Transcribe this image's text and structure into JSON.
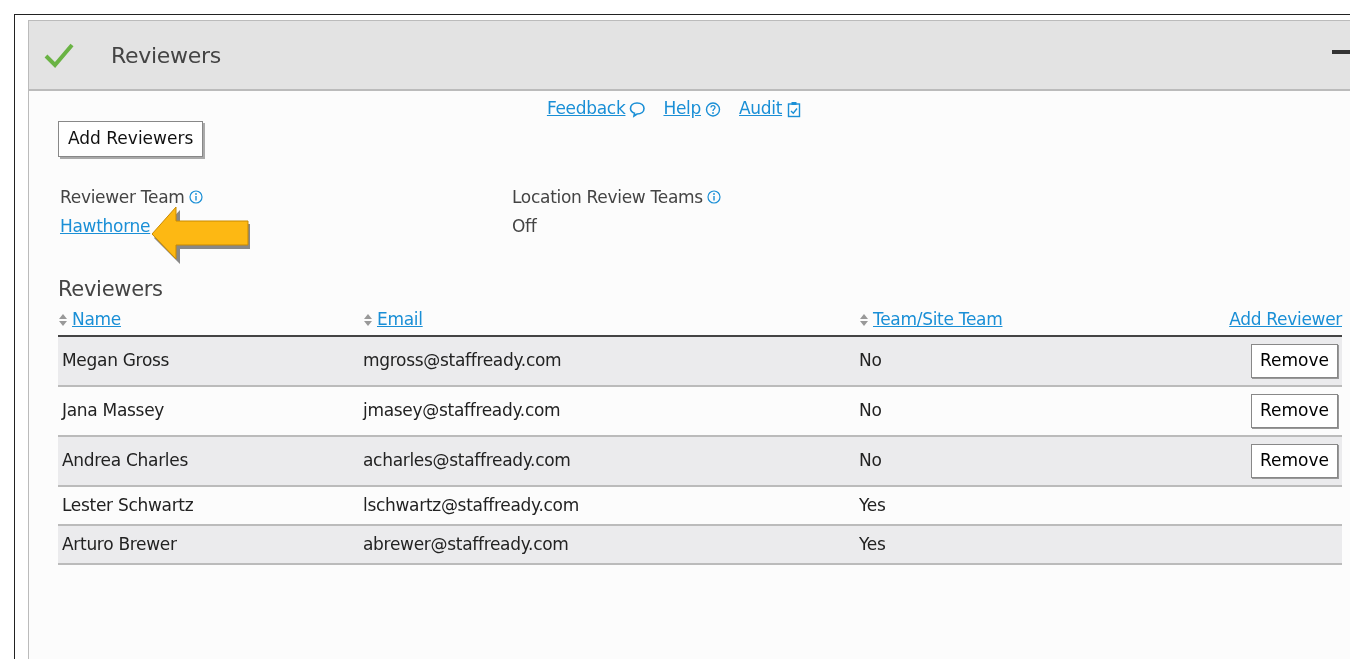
{
  "panel": {
    "title": "Reviewers",
    "complete": true
  },
  "links": [
    {
      "label": "Feedback",
      "kind": "comment"
    },
    {
      "label": "Help",
      "kind": "help"
    },
    {
      "label": "Audit",
      "kind": "clipboard"
    }
  ],
  "add_button": "Add Reviewers",
  "fields": [
    {
      "label": "Reviewer Team",
      "value": "Hawthorne",
      "kind": "link"
    },
    {
      "label": "Location Review Teams",
      "value": "Off",
      "kind": "text"
    }
  ],
  "table": {
    "title": "Reviewers",
    "columns": [
      {
        "label": "Name",
        "sortable": true
      },
      {
        "label": "Email",
        "sortable": true
      },
      {
        "label": "Team/Site Team",
        "sortable": true
      }
    ],
    "action_link": "Add Reviewer",
    "rows": [
      {
        "name": "Megan Gross",
        "email": "mgross@staffready.com",
        "team": "No",
        "action": "Remove"
      },
      {
        "name": "Jana Massey",
        "email": "jmasey@staffready.com",
        "team": "No",
        "action": "Remove"
      },
      {
        "name": "Andrea Charles",
        "email": "acharles@staffready.com",
        "team": "No",
        "action": "Remove"
      },
      {
        "name": "Lester Schwartz",
        "email": "lschwartz@staffready.com",
        "team": "Yes"
      },
      {
        "name": "Arturo Brewer",
        "email": "abrewer@staffready.com",
        "team": "Yes"
      }
    ]
  }
}
